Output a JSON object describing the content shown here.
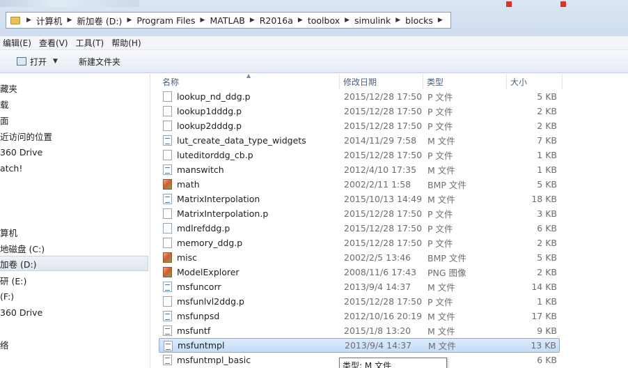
{
  "address": {
    "crumbs": [
      "计算机",
      "新加卷 (D:)",
      "Program Files",
      "MATLAB",
      "R2016a",
      "toolbox",
      "simulink",
      "blocks"
    ]
  },
  "menu": [
    "编辑(E)",
    "查看(V)",
    "工具(T)",
    "帮助(H)"
  ],
  "toolbar": {
    "open": "打开",
    "new_folder": "新建文件夹"
  },
  "sidebar": [
    "藏夹",
    "载",
    "面",
    "近访问的位置",
    "360 Drive",
    "atch!",
    "算机",
    "地磁盘 (C:)",
    "加卷 (D:)",
    "研 (E:)",
    "(F:)",
    "360 Drive",
    "络"
  ],
  "columns": {
    "name": "名称",
    "date": "修改日期",
    "type": "类型",
    "size": "大小"
  },
  "files": [
    {
      "name": "lookup_nd_ddg.p",
      "date": "2015/12/28 17:50",
      "type": "P 文件",
      "size": "5 KB",
      "icon": "p-file-icon"
    },
    {
      "name": "lookup1dddg.p",
      "date": "2015/12/28 17:50",
      "type": "P 文件",
      "size": "2 KB",
      "icon": "p-file-icon"
    },
    {
      "name": "lookup2dddg.p",
      "date": "2015/12/28 17:50",
      "type": "P 文件",
      "size": "2 KB",
      "icon": "p-file-icon"
    },
    {
      "name": "lut_create_data_type_widgets",
      "date": "2014/11/29 7:58",
      "type": "M 文件",
      "size": "7 KB",
      "icon": "m-file-icon"
    },
    {
      "name": "luteditorddg_cb.p",
      "date": "2015/12/28 17:50",
      "type": "P 文件",
      "size": "1 KB",
      "icon": "p-file-icon"
    },
    {
      "name": "manswitch",
      "date": "2012/4/10 17:35",
      "type": "M 文件",
      "size": "1 KB",
      "icon": "m-file-icon"
    },
    {
      "name": "math",
      "date": "2002/2/11 1:58",
      "type": "BMP 文件",
      "size": "5 KB",
      "icon": "bmp-file-icon"
    },
    {
      "name": "MatrixInterpolation",
      "date": "2015/10/13 14:49",
      "type": "M 文件",
      "size": "18 KB",
      "icon": "m-file-icon"
    },
    {
      "name": "MatrixInterpolation.p",
      "date": "2015/12/28 17:50",
      "type": "P 文件",
      "size": "3 KB",
      "icon": "p-file-icon"
    },
    {
      "name": "mdlrefddg.p",
      "date": "2015/12/28 17:50",
      "type": "P 文件",
      "size": "6 KB",
      "icon": "p-file-icon"
    },
    {
      "name": "memory_ddg.p",
      "date": "2015/12/28 17:50",
      "type": "P 文件",
      "size": "2 KB",
      "icon": "p-file-icon"
    },
    {
      "name": "misc",
      "date": "2002/2/5 13:46",
      "type": "BMP 文件",
      "size": "5 KB",
      "icon": "bmp-file-icon"
    },
    {
      "name": "ModelExplorer",
      "date": "2008/11/6 17:43",
      "type": "PNG 图像",
      "size": "2 KB",
      "icon": "png-file-icon"
    },
    {
      "name": "msfuncorr",
      "date": "2013/9/4 14:37",
      "type": "M 文件",
      "size": "14 KB",
      "icon": "m-file-icon"
    },
    {
      "name": "msfunlvl2ddg.p",
      "date": "2015/12/28 17:50",
      "type": "P 文件",
      "size": "1 KB",
      "icon": "p-file-icon"
    },
    {
      "name": "msfunpsd",
      "date": "2012/10/16 20:19",
      "type": "M 文件",
      "size": "17 KB",
      "icon": "m-file-icon"
    },
    {
      "name": "msfuntf",
      "date": "2015/1/8 13:20",
      "type": "M 文件",
      "size": "9 KB",
      "icon": "m-file-icon"
    },
    {
      "name": "msfuntmpl",
      "date": "2013/9/4 14:37",
      "type": "M 文件",
      "size": "13 KB",
      "icon": "m-file-icon",
      "selected": true
    },
    {
      "name": "msfuntmpl_basic",
      "date": "",
      "type": "",
      "size": "6 KB",
      "icon": "m-file-icon"
    }
  ],
  "tooltip": "类型: M 文件",
  "colors": {
    "selection": "#cfe3fb",
    "selection_border": "#84acdd",
    "header_text": "#4c607a"
  }
}
